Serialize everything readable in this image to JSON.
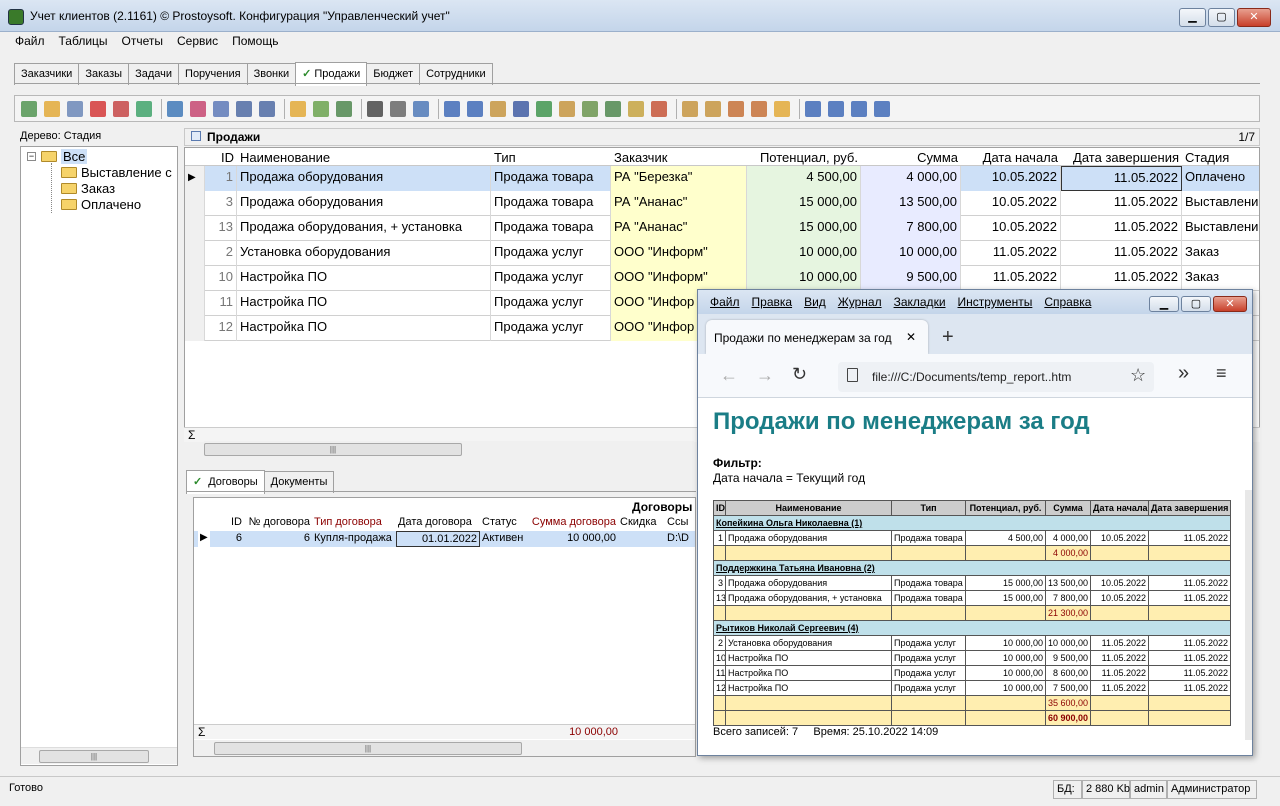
{
  "window": {
    "title": "Учет клиентов (2.1161) © Prostoysoft. Конфигурация \"Управленческий учет\""
  },
  "menu": [
    "Файл",
    "Таблицы",
    "Отчеты",
    "Сервис",
    "Помощь"
  ],
  "tabs": [
    "Заказчики",
    "Заказы",
    "Задачи",
    "Поручения",
    "Звонки",
    "Продажи",
    "Бюджет",
    "Сотрудники"
  ],
  "active_tab_check": "✓",
  "tree": {
    "title": "Дерево: Стадия",
    "root": "Все",
    "items": [
      "Выставление с",
      "Заказ",
      "Оплачено"
    ],
    "expander": "−"
  },
  "sales": {
    "title": "Продажи",
    "counter": "1/7",
    "sum_symbol": "Σ",
    "columns": [
      "ID",
      "Наименование",
      "Тип",
      "Заказчик",
      "Потенциал, руб.",
      "Сумма",
      "Дата начала",
      "Дата завершения",
      "Стадия"
    ],
    "rows": [
      [
        "1",
        "Продажа оборудования",
        "Продажа товара",
        "РА \"Березка\"",
        "4 500,00",
        "4 000,00",
        "10.05.2022",
        "11.05.2022",
        "Оплачено"
      ],
      [
        "3",
        "Продажа оборудования",
        "Продажа товара",
        "РА \"Ананас\"",
        "15 000,00",
        "13 500,00",
        "10.05.2022",
        "11.05.2022",
        "Выставлени"
      ],
      [
        "13",
        "Продажа оборудования, + установка",
        "Продажа товара",
        "РА \"Ананас\"",
        "15 000,00",
        "7 800,00",
        "10.05.2022",
        "11.05.2022",
        "Выставлени"
      ],
      [
        "2",
        "Установка оборудования",
        "Продажа услуг",
        "ООО \"Информ\"",
        "10 000,00",
        "10 000,00",
        "11.05.2022",
        "11.05.2022",
        "Заказ"
      ],
      [
        "10",
        "Настройка ПО",
        "Продажа услуг",
        "ООО \"Информ\"",
        "10 000,00",
        "9 500,00",
        "11.05.2022",
        "11.05.2022",
        "Заказ"
      ],
      [
        "11",
        "Настройка ПО",
        "Продажа услуг",
        "ООО \"Инфор",
        "",
        "",
        "",
        "",
        ""
      ],
      [
        "12",
        "Настройка ПО",
        "Продажа услуг",
        "ООО \"Инфор",
        "",
        "",
        "",
        "",
        ""
      ]
    ]
  },
  "subtabs": [
    "Договоры",
    "Документы"
  ],
  "contracts": {
    "title": "Договоры",
    "sum_symbol": "Σ",
    "sum_value": "10 000,00",
    "columns": [
      "ID",
      "№ договора",
      "Тип договора",
      "Дата договора",
      "Статус",
      "Сумма договора",
      "Скидка",
      "Ссы"
    ],
    "rows": [
      [
        "6",
        "6",
        "Купля-продажа",
        "01.01.2022",
        "Активен",
        "10 000,00",
        "",
        "D:\\D"
      ]
    ]
  },
  "status": {
    "text": "Готово",
    "db_label": "БД:",
    "db_size": "2 880 Kb",
    "user": "admin",
    "role": "Администратор"
  },
  "browser": {
    "menu": [
      "Файл",
      "Правка",
      "Вид",
      "Журнал",
      "Закладки",
      "Инструменты",
      "Справка"
    ],
    "tab_title": "Продажи по менеджерам за год",
    "tab_close": "✕",
    "new_tab": "+",
    "url": "file:///C:/Documents/temp_report..htm",
    "report": {
      "title": "Продажи по менеджерам за год",
      "filter_label": "Фильтр:",
      "filter_value": "Дата начала = Текущий год",
      "columns": [
        "ID",
        "Наименование",
        "Тип",
        "Потенциал, руб.",
        "Сумма",
        "Дата начала",
        "Дата завершения"
      ],
      "groups": [
        {
          "name": "Копейкина Ольга Николаевна (1)",
          "rows": [
            [
              "1",
              "Продажа оборудования",
              "Продажа товара",
              "4 500,00",
              "4 000,00",
              "10.05.2022",
              "11.05.2022"
            ]
          ],
          "total": "4 000,00"
        },
        {
          "name": "Поддержкина Татьяна Ивановна (2)",
          "rows": [
            [
              "3",
              "Продажа оборудования",
              "Продажа товара",
              "15 000,00",
              "13 500,00",
              "10.05.2022",
              "11.05.2022"
            ],
            [
              "13",
              "Продажа оборудования, + установка",
              "Продажа товара",
              "15 000,00",
              "7 800,00",
              "10.05.2022",
              "11.05.2022"
            ]
          ],
          "total": "21 300,00"
        },
        {
          "name": "Рытиков Николай Сергеевич (4)",
          "rows": [
            [
              "2",
              "Установка оборудования",
              "Продажа услуг",
              "10 000,00",
              "10 000,00",
              "11.05.2022",
              "11.05.2022"
            ],
            [
              "10",
              "Настройка ПО",
              "Продажа услуг",
              "10 000,00",
              "9 500,00",
              "11.05.2022",
              "11.05.2022"
            ],
            [
              "11",
              "Настройка ПО",
              "Продажа услуг",
              "10 000,00",
              "8 600,00",
              "11.05.2022",
              "11.05.2022"
            ],
            [
              "12",
              "Настройка ПО",
              "Продажа услуг",
              "10 000,00",
              "7 500,00",
              "11.05.2022",
              "11.05.2022"
            ]
          ],
          "total": "35 600,00"
        }
      ],
      "grand_total": "60 900,00",
      "footer": "Всего записей: 7     Время: 25.10.2022 14:09"
    }
  },
  "colors": {
    "accent": "#1a7d86",
    "selection": "#cde0f7",
    "customer": "#ffffcc",
    "potential": "#e6f5e0",
    "sum": "#e8ebff"
  }
}
